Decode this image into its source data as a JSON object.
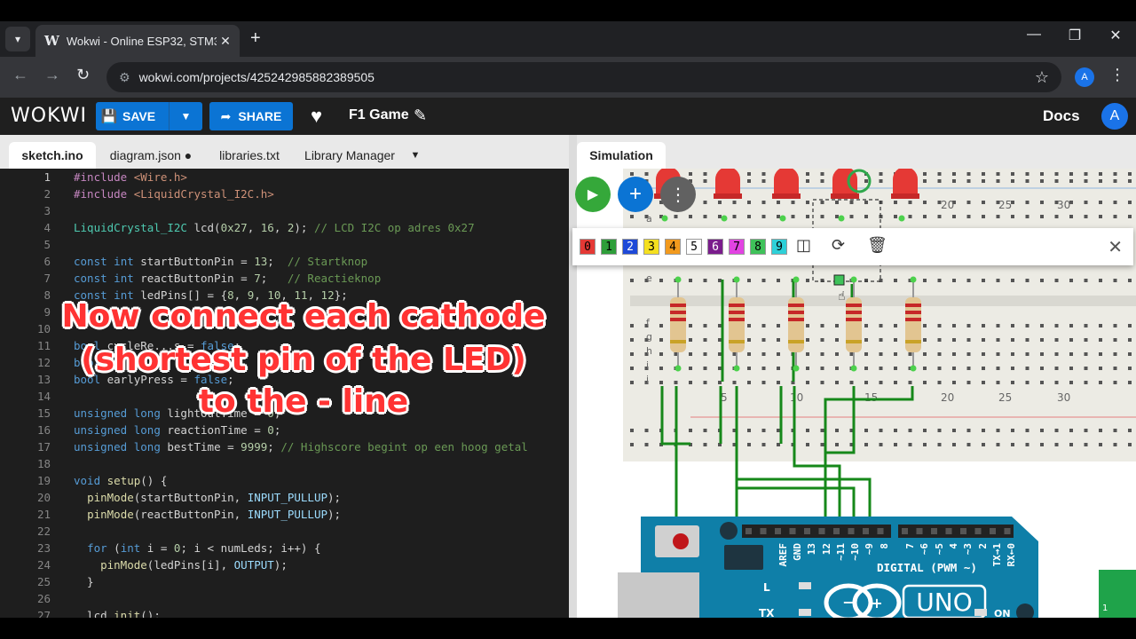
{
  "browser": {
    "tab_title": "Wokwi - Online ESP32, STM32,",
    "tab_favicon": "W",
    "url": "wokwi.com/projects/425242985882389505",
    "profile_initial": "A"
  },
  "header": {
    "logo": "WOKWI",
    "save_label": "SAVE",
    "share_label": "SHARE",
    "project_title": "F1 Game",
    "docs_label": "Docs",
    "avatar_initial": "A"
  },
  "editor": {
    "tabs": [
      "sketch.ino",
      "diagram.json ●",
      "libraries.txt",
      "Library Manager"
    ],
    "active_tab": "sketch.ino"
  },
  "code_lines": [
    {
      "n": "1",
      "t": "#include <Wire.h>"
    },
    {
      "n": "2",
      "t": "#include <LiquidCrystal_I2C.h>"
    },
    {
      "n": "3",
      "t": ""
    },
    {
      "n": "4",
      "t": "LiquidCrystal_I2C lcd(0x27, 16, 2); // LCD I2C op adres 0x27"
    },
    {
      "n": "5",
      "t": ""
    },
    {
      "n": "6",
      "t": "const int startButtonPin = 13;  // Startknop"
    },
    {
      "n": "7",
      "t": "const int reactButtonPin = 7;   // Reactieknop"
    },
    {
      "n": "8",
      "t": "const int ledPins[] = {8, 9, 10, 11, 12};"
    },
    {
      "n": "9",
      "t": "const i"
    },
    {
      "n": "10",
      "t": ""
    },
    {
      "n": "11",
      "t": "bool cycleRe...s = false;"
    },
    {
      "n": "12",
      "t": "bool ...P...;"
    },
    {
      "n": "13",
      "t": "bool earlyPress = false;"
    },
    {
      "n": "14",
      "t": ""
    },
    {
      "n": "15",
      "t": "unsigned long lightOutTime = 0;"
    },
    {
      "n": "16",
      "t": "unsigned long reactionTime = 0;"
    },
    {
      "n": "17",
      "t": "unsigned long bestTime = 9999; // Highscore begint op een hoog getal"
    },
    {
      "n": "18",
      "t": ""
    },
    {
      "n": "19",
      "t": "void setup() {"
    },
    {
      "n": "20",
      "t": "  pinMode(startButtonPin, INPUT_PULLUP);"
    },
    {
      "n": "21",
      "t": "  pinMode(reactButtonPin, INPUT_PULLUP);"
    },
    {
      "n": "22",
      "t": ""
    },
    {
      "n": "23",
      "t": "  for (int i = 0; i < numLeds; i++) {"
    },
    {
      "n": "24",
      "t": "    pinMode(ledPins[i], OUTPUT);"
    },
    {
      "n": "25",
      "t": "  }"
    },
    {
      "n": "26",
      "t": ""
    },
    {
      "n": "27",
      "t": "  lcd.init();"
    }
  ],
  "simulation": {
    "tab": "Simulation",
    "wire_colors": [
      {
        "label": "0",
        "bg": "#e53935",
        "fg": "#000000"
      },
      {
        "label": "1",
        "bg": "#2e9e3a",
        "fg": "#000000"
      },
      {
        "label": "2",
        "bg": "#1e49d8",
        "fg": "#ffffff"
      },
      {
        "label": "3",
        "bg": "#f5e020",
        "fg": "#000000"
      },
      {
        "label": "4",
        "bg": "#f29a1d",
        "fg": "#000000"
      },
      {
        "label": "5",
        "bg": "#ffffff",
        "fg": "#000000"
      },
      {
        "label": "6",
        "bg": "#7a1c8c",
        "fg": "#ffffff"
      },
      {
        "label": "7",
        "bg": "#e243e2",
        "fg": "#000000"
      },
      {
        "label": "8",
        "bg": "#3fc25a",
        "fg": "#000000"
      },
      {
        "label": "9",
        "bg": "#2ed0d8",
        "fg": "#000000"
      }
    ],
    "breadboard_cols_top": [
      "20",
      "25",
      "30"
    ],
    "breadboard_cols_mid": [
      "5",
      "10",
      "15",
      "20",
      "25",
      "30"
    ],
    "breadboard_rows_top": [
      "a",
      "e"
    ],
    "breadboard_rows_bottom": [
      "f",
      "g",
      "h",
      "i",
      "j"
    ],
    "arduino_pins": [
      "AREF",
      "GND",
      "13",
      "12",
      "~11",
      "~10",
      "~9",
      "8",
      "7",
      "~6",
      "~5",
      "4",
      "~3",
      "2",
      "TX→1",
      "RX←0"
    ],
    "arduino_digital_label": "DIGITAL (PWM ~)",
    "arduino_uno": "UNO",
    "arduino_l": "L",
    "arduino_tx": "TX",
    "arduino_on": "ON",
    "arduino_logo": "∞",
    "side_board_label": "1"
  },
  "overlay_caption": [
    "Now connect each cathode",
    "(shortest pin of the LED)",
    "to the - line"
  ]
}
